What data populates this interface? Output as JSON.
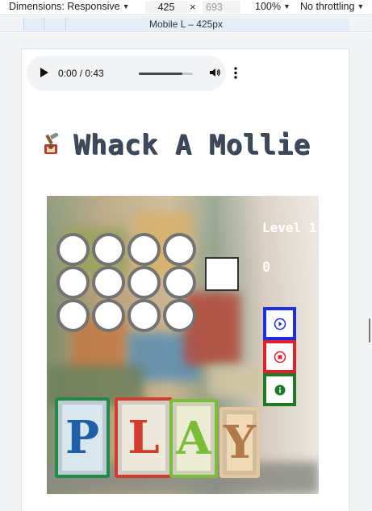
{
  "devtools": {
    "dimensions_label": "Dimensions: Responsive",
    "width": "425",
    "times": "×",
    "height": "693",
    "zoom": "100%",
    "throttle": "No throttling",
    "media_label": "Mobile L – 425px"
  },
  "audio": {
    "time": "0:00 / 0:43",
    "progress_fraction": 0.8,
    "icons": [
      "play-icon",
      "volume-icon",
      "more-vert-icon"
    ]
  },
  "page": {
    "title": "Whack A Mollie",
    "title_icon": "hammer-mole-icon"
  },
  "game": {
    "level": "Level 1",
    "score": "0",
    "hole_rows": 3,
    "hole_cols": 4,
    "blocks": [
      "P",
      "L",
      "A",
      "Y"
    ],
    "controls": [
      {
        "name": "play-button",
        "icon": "play-circle-icon",
        "color": "#1d2fe0"
      },
      {
        "name": "stop-button",
        "icon": "stop-circle-icon",
        "color": "#e0202a"
      },
      {
        "name": "info-button",
        "icon": "info-circle-icon",
        "color": "#1f7a26"
      }
    ]
  }
}
